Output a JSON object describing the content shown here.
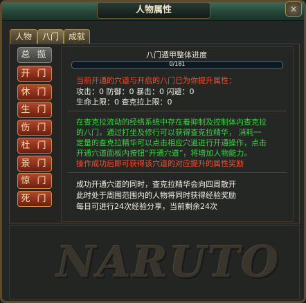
{
  "window": {
    "title": "人物属性",
    "close_label": "×"
  },
  "tabs": [
    {
      "label": "人物",
      "active": false
    },
    {
      "label": "八门",
      "active": true
    },
    {
      "label": "成就",
      "active": false
    }
  ],
  "side_buttons": [
    "总 揽",
    "开 门",
    "休 门",
    "生 门",
    "伤 门",
    "杜 门",
    "景 门",
    "惊 门",
    "死 门"
  ],
  "progress": {
    "title": "八门遁甲整体进度",
    "current": 0,
    "total": 181,
    "text": "0/181",
    "fraction": 0.0,
    "fill_color": "#3e9bc4"
  },
  "attributes": {
    "header": "当前开通的穴道与开启的八门已为你提升属性：",
    "row1": "攻击：0 防御：0 暴击：0 闪避：0",
    "row2": "生命上限：0 查克拉上限：0"
  },
  "description": {
    "lines_green": [
      "在查克拉流动的经络系统中存在着抑制及控制体内查克拉",
      "的八门，通过打坐及修行可以获得查克拉精华， 消耗一",
      "定量的查克拉精华可以点击相应穴道进行开通操作，点击",
      "开通穴道面板内按钮“开通穴道”，将增加人物能力。"
    ],
    "line_red": "操作成功后即可获得该穴道的对应提升的属性奖励"
  },
  "sharing": {
    "line1": "成功开通穴道的同时，查克拉精华会向四周散开",
    "line2": "此时处于周围范围内的人物将同时获得经验奖励",
    "line3": "每日可进行24次经验分享，当前剩余24次"
  },
  "logo_text": "NARUTO",
  "colors": {
    "red": "#ff4a2a",
    "green": "#39d341",
    "title_bar": "#2e5646",
    "button_red": "#a8422a"
  }
}
